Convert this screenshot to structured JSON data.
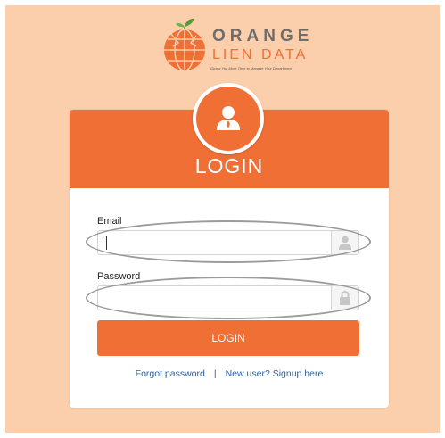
{
  "logo": {
    "line1": "ORANGE",
    "line2": "LIEN DATA",
    "tagline": "Giving You More Time to Manage Your Department"
  },
  "card": {
    "title": "LOGIN",
    "email_label": "Email",
    "email_value": "",
    "password_label": "Password",
    "password_value": "",
    "submit_label": "LOGIN",
    "forgot_link": "Forgot password",
    "separator": "|",
    "signup_link": "New user? Signup here"
  },
  "icons": {
    "avatar": "user-avatar-icon",
    "email_addon": "user-icon",
    "password_addon": "lock-icon"
  },
  "colors": {
    "background": "#fccfac",
    "accent": "#ef6f35",
    "link": "#2a62a3",
    "logo_gray": "#6d6d6d"
  }
}
